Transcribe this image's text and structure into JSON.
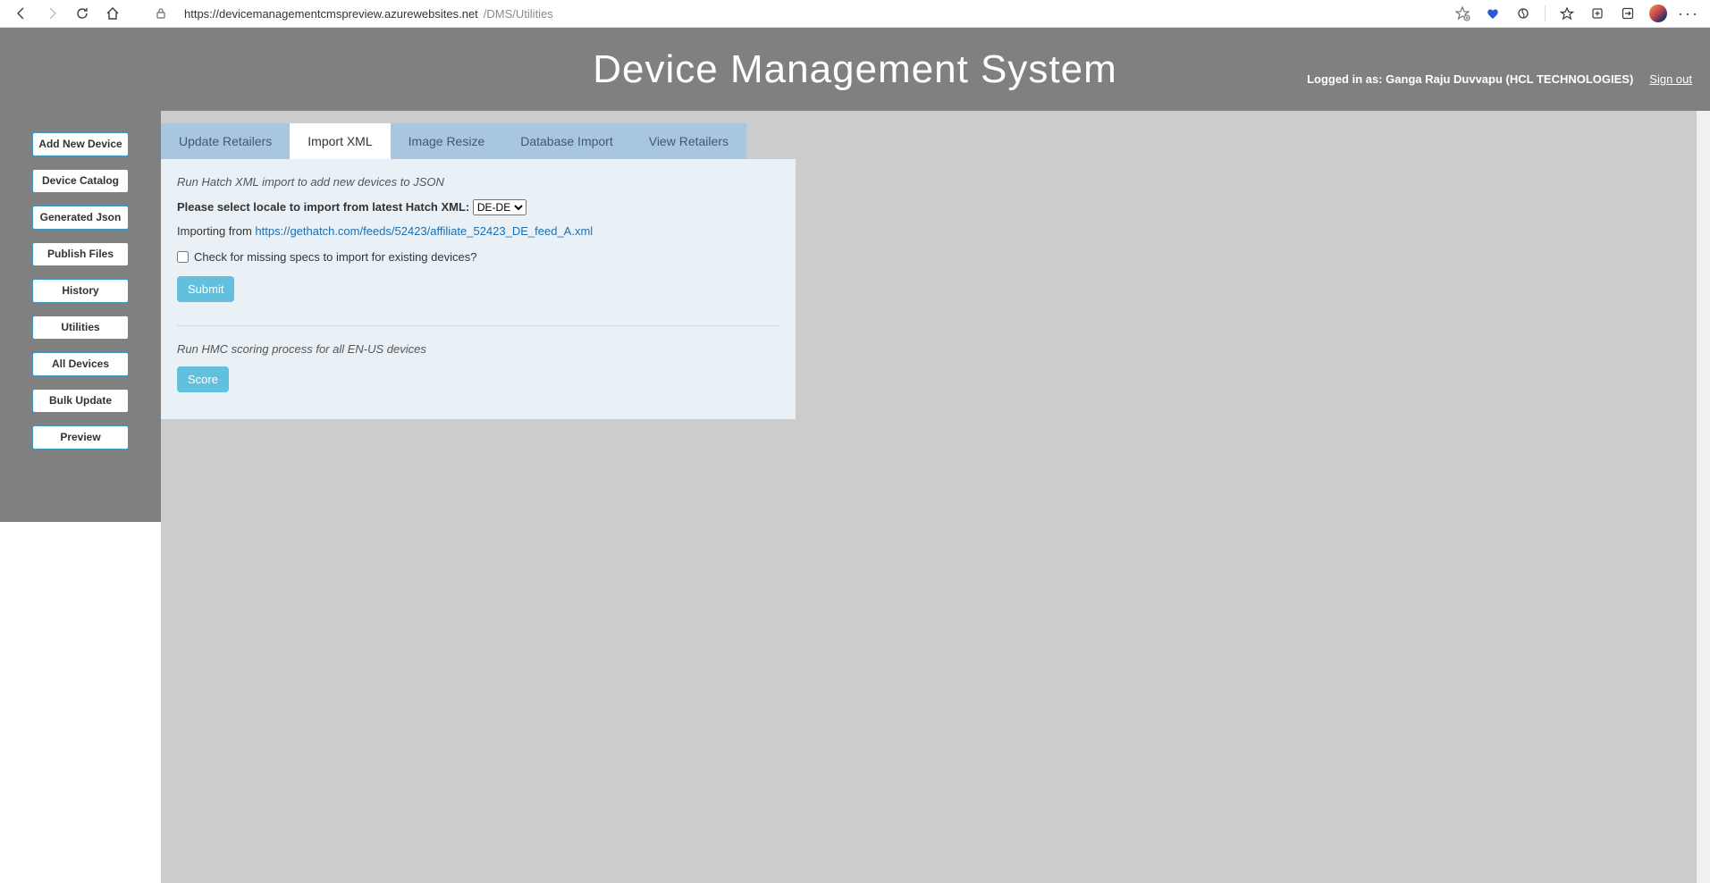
{
  "browser": {
    "url_prefix": "https://",
    "url_domain": "devicemanagementcmspreview.azurewebsites.net",
    "url_path": "/DMS/Utilities"
  },
  "header": {
    "title": "Device Management System",
    "logged_in_label": "Logged in as: Ganga Raju Duvvapu (HCL TECHNOLOGIES)",
    "sign_out": "Sign out"
  },
  "sidebar": {
    "items": [
      "Add New Device",
      "Device Catalog",
      "Generated Json",
      "Publish Files",
      "History",
      "Utilities",
      "All Devices",
      "Bulk Update",
      "Preview"
    ]
  },
  "tabs": {
    "items": [
      "Update Retailers",
      "Import XML",
      "Image Resize",
      "Database Import",
      "View Retailers"
    ],
    "active_index": 1
  },
  "panel": {
    "desc1": "Run Hatch XML import to add new devices to JSON",
    "locale_label": "Please select locale to import from latest Hatch XML:",
    "locale_value": "DE-DE",
    "importing_label": "Importing from ",
    "importing_url": "https://gethatch.com/feeds/52423/affiliate_52423_DE_feed_A.xml",
    "checkbox_label": "Check for missing specs to import for existing devices?",
    "submit_label": "Submit",
    "desc2": "Run HMC scoring process for all EN-US devices",
    "score_label": "Score"
  }
}
